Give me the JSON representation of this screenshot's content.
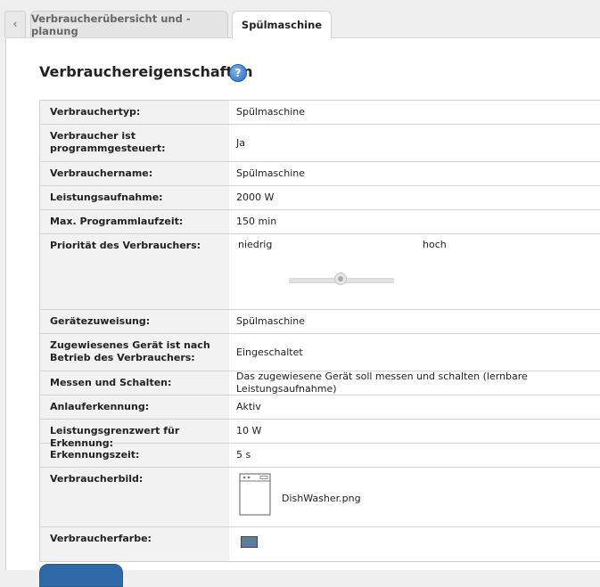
{
  "tabs": {
    "back_icon": "chevron-left-icon",
    "items": [
      {
        "label": "Verbraucherübersicht und -planung",
        "active": false
      },
      {
        "label": "Spülmaschine",
        "active": true
      }
    ]
  },
  "section": {
    "title": "Verbrauchereigenschaften",
    "help_icon": "?"
  },
  "rows": {
    "typ": {
      "label": "Verbrauchertyp:",
      "value": "Spülmaschine"
    },
    "programm": {
      "label": "Verbraucher ist programmgesteuert:",
      "value": "Ja"
    },
    "name": {
      "label": "Verbrauchername:",
      "value": "Spülmaschine"
    },
    "leistung": {
      "label": "Leistungsaufnahme:",
      "value": "2000 W"
    },
    "laufzeit": {
      "label": "Max. Programmlaufzeit:",
      "value": "150 min"
    },
    "prioritaet": {
      "label": "Priorität des Verbrauchers:",
      "low": "niedrig",
      "high": "hoch",
      "level": 0.5
    },
    "geraet": {
      "label": "Gerätezuweisung:",
      "value": "Spülmaschine"
    },
    "betrieb": {
      "label": "Zugewiesenes Gerät ist nach Betrieb des Verbrauchers:",
      "value": "Eingeschaltet"
    },
    "messen": {
      "label": "Messen und Schalten:",
      "value": "Das zugewiesene Gerät soll messen und schalten (lernbare Leistungsaufnahme)"
    },
    "anlauf": {
      "label": "Anlauferkennung:",
      "value": "Aktiv"
    },
    "grenzwert": {
      "label": "Leistungsgrenzwert für Erkennung:",
      "value": "10 W"
    },
    "erkennungszeit": {
      "label": "Erkennungszeit:",
      "value": "5 s"
    },
    "bild": {
      "label": "Verbraucherbild:",
      "file": "DishWasher.png",
      "icon": "dishwasher-icon"
    },
    "farbe": {
      "label": "Verbraucherfarbe:",
      "color": "#5b7fa0"
    }
  },
  "colors": {
    "accent": "#2e6aa9",
    "swatch": "#5b7fa0"
  }
}
